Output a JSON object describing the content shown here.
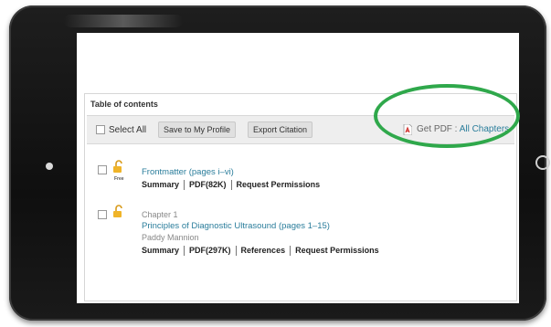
{
  "toc": {
    "title": "Table of contents",
    "select_all": "Select All",
    "save_profile": "Save to My Profile",
    "export_citation": "Export Citation",
    "get_pdf_prefix": "Get PDF : ",
    "get_pdf_link": "All Chapters",
    "highlight_color": "#2fa84b",
    "link_color": "#2a7d9b"
  },
  "entries": [
    {
      "free_tag": "Free",
      "title": "Frontmatter (pages i–vi)",
      "links": [
        "Summary",
        "PDF(82K)",
        "Request Permissions"
      ]
    },
    {
      "chapter": "Chapter 1",
      "title": "Principles of Diagnostic Ultrasound (pages 1–15)",
      "author": "Paddy Mannion",
      "links": [
        "Summary",
        "PDF(297K)",
        "References",
        "Request Permissions"
      ]
    }
  ]
}
